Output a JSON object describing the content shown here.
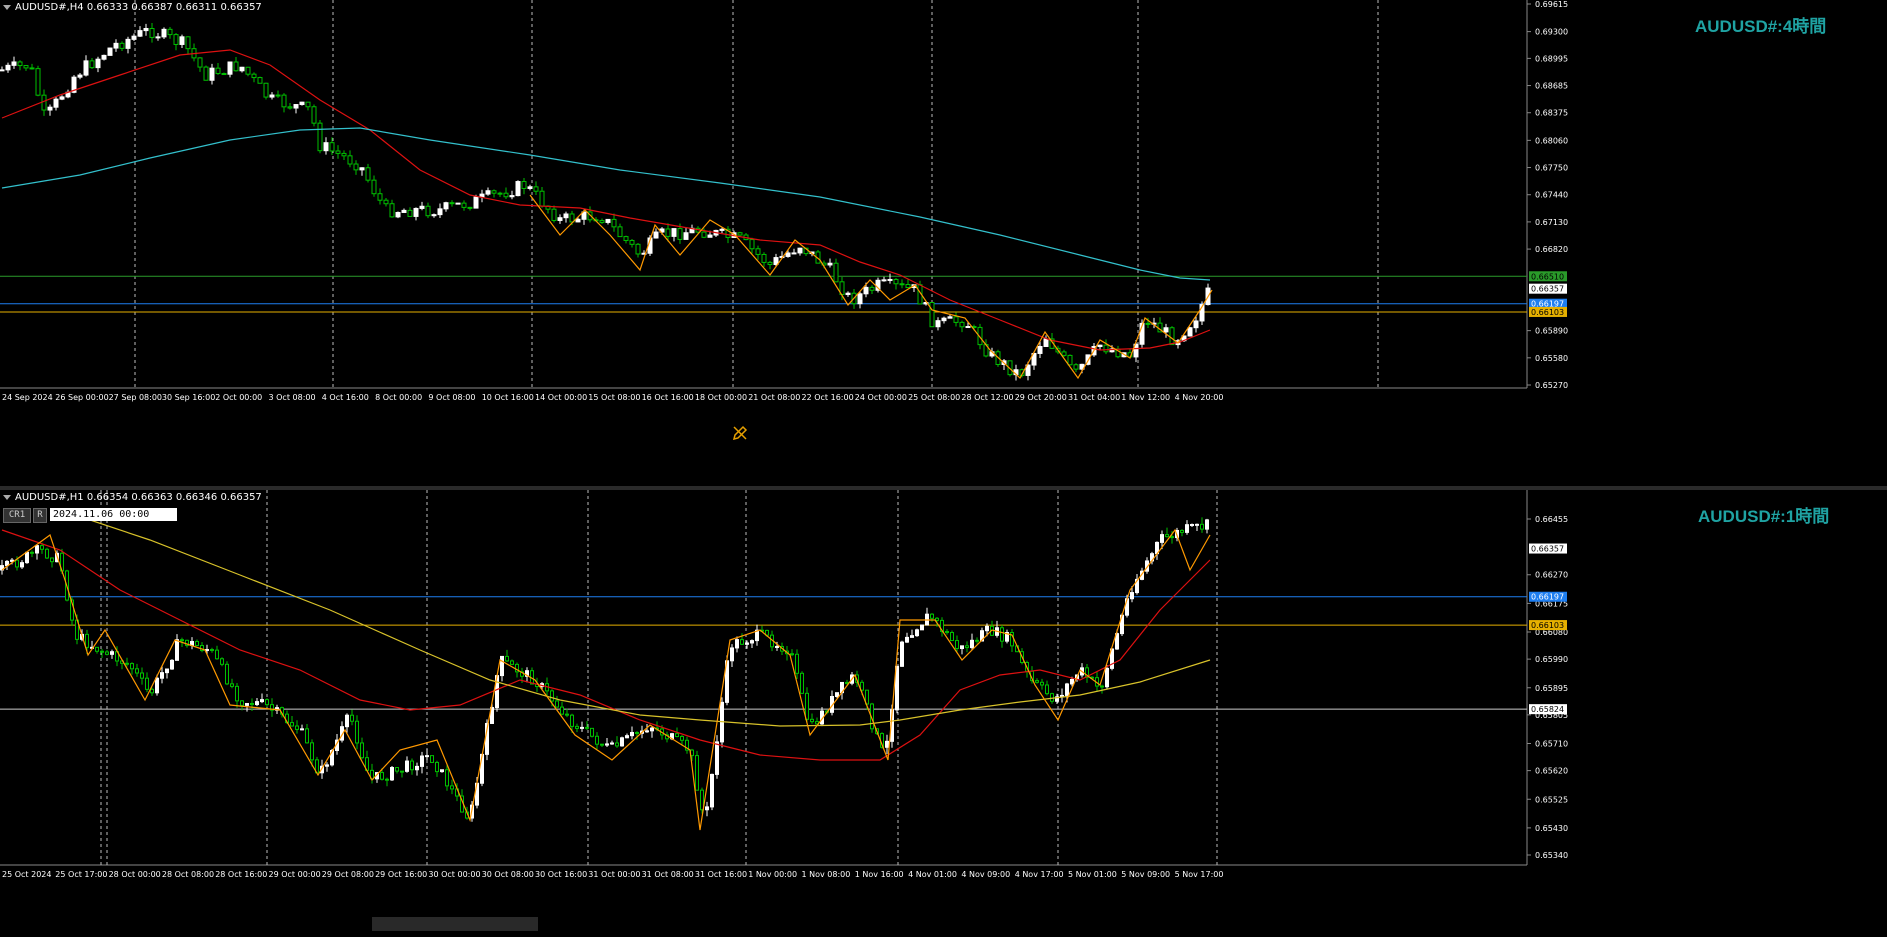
{
  "top": {
    "header": "AUDUSD#,H4  0.66333 0.66387 0.66311 0.66357",
    "title": "AUDUSD#:4時間",
    "price_ticks": [
      "0.69615",
      "0.69300",
      "0.68995",
      "0.68685",
      "0.68375",
      "0.68060",
      "0.67750",
      "0.67440",
      "0.67130",
      "0.66820",
      "0.66510",
      "0.66357",
      "0.66197",
      "0.66103",
      "0.65890",
      "0.65580",
      "0.65270"
    ],
    "time_ticks": [
      "24 Sep 2024",
      "26 Sep 00:00",
      "27 Sep 08:00",
      "30 Sep 16:00",
      "2 Oct 00:00",
      "3 Oct 08:00",
      "4 Oct 16:00",
      "8 Oct 00:00",
      "9 Oct 08:00",
      "10 Oct 16:00",
      "14 Oct 00:00",
      "15 Oct 08:00",
      "16 Oct 16:00",
      "18 Oct 00:00",
      "21 Oct 08:00",
      "22 Oct 16:00",
      "24 Oct 00:00",
      "25 Oct 08:00",
      "28 Oct 12:00",
      "29 Oct 20:00",
      "31 Oct 04:00",
      "1 Nov 12:00",
      "4 Nov 20:00"
    ],
    "levels": {
      "green": "0.66510",
      "current": "0.66357",
      "blue": "0.66197",
      "orange": "0.66103"
    }
  },
  "bottom": {
    "header": "AUDUSD#,H1  0.66354 0.66363 0.66346 0.66357",
    "title": "AUDUSD#:1時間",
    "cr_label": "CR1",
    "r_label": "R",
    "date_value": "2024.11.06 00:00",
    "price_ticks": [
      "0.66455",
      "0.66357",
      "0.66270",
      "0.66197",
      "0.66175",
      "0.66103",
      "0.66080",
      "0.65990",
      "0.65895",
      "0.65824",
      "0.65805",
      "0.65710",
      "0.65620",
      "0.65525",
      "0.65430",
      "0.65340"
    ],
    "time_ticks": [
      "25 Oct 2024",
      "25 Oct 17:00",
      "28 Oct 00:00",
      "28 Oct 08:00",
      "28 Oct 16:00",
      "29 Oct 00:00",
      "29 Oct 08:00",
      "29 Oct 16:00",
      "30 Oct 00:00",
      "30 Oct 08:00",
      "30 Oct 16:00",
      "31 Oct 00:00",
      "31 Oct 08:00",
      "31 Oct 16:00",
      "1 Nov 00:00",
      "1 Nov 08:00",
      "1 Nov 16:00",
      "4 Nov 01:00",
      "4 Nov 09:00",
      "4 Nov 17:00",
      "5 Nov 01:00",
      "5 Nov 09:00",
      "5 Nov 17:00"
    ],
    "levels": {
      "current": "0.66357",
      "blue": "0.66197",
      "orange": "0.66103",
      "white": "0.65824"
    }
  },
  "colors": {
    "bull": "#ffffff",
    "bear": "#00c000",
    "ma_red": "#d11",
    "ma_cyan": "#33c0cc",
    "ma_yellow": "#d8c22a",
    "zigzag": "#ff9900",
    "blue_line": "#1e7ef0",
    "orange_line": "#e6b000",
    "green_line": "#2a9a2a"
  }
}
